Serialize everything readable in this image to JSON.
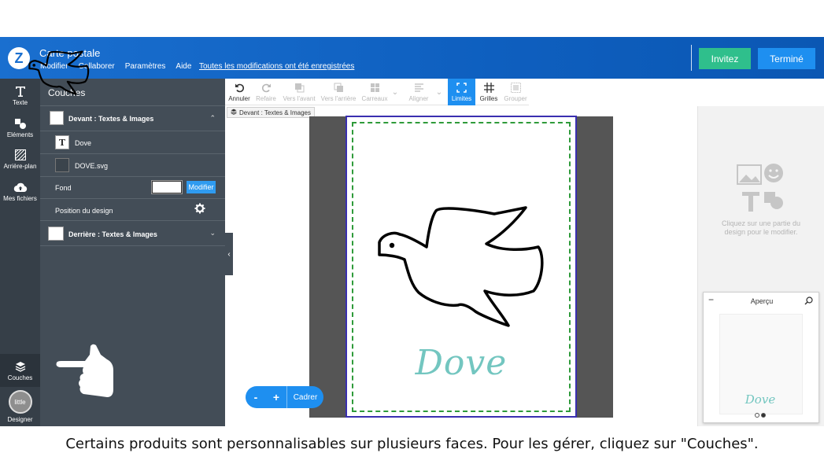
{
  "header": {
    "title": "Carte postale",
    "menu": [
      "Modifier",
      "Collaborer",
      "Paramètres",
      "Aide"
    ],
    "saved_status": "Toutes les modifications ont été enregistrées",
    "invite_label": "Invitez",
    "done_label": "Terminé",
    "logo_icon": "zazzle-logo-icon"
  },
  "rail": {
    "items": [
      {
        "label": "Texte",
        "icon": "text-icon"
      },
      {
        "label": "Eléments",
        "icon": "elements-icon"
      },
      {
        "label": "Arrière-plan",
        "icon": "background-icon"
      },
      {
        "label": "Mes fichiers",
        "icon": "upload-cloud-icon"
      }
    ],
    "layers_label": "Couches",
    "designer_label": "Designer",
    "designer_badge": "little"
  },
  "layers": {
    "title": "Couches",
    "front_group": "Devant : Textes & Images",
    "items": [
      "Dove",
      "DOVE.svg"
    ],
    "fond_label": "Fond",
    "fond_button": "Modifier",
    "position_label": "Position du design",
    "back_group": "Derrière : Textes & Images"
  },
  "toolbar": {
    "tools": [
      {
        "label": "Annuler",
        "icon": "undo-icon",
        "enabled": true
      },
      {
        "label": "Refaire",
        "icon": "redo-icon",
        "enabled": false
      },
      {
        "label": "Vers l'avant",
        "icon": "bring-forward-icon",
        "enabled": false
      },
      {
        "label": "Vers l'arrière",
        "icon": "send-backward-icon",
        "enabled": false
      },
      {
        "label": "Carreaux",
        "icon": "tiles-icon",
        "enabled": false
      },
      {
        "label": "Aligner",
        "icon": "align-icon",
        "enabled": false
      },
      {
        "label": "Limites",
        "icon": "bounds-icon",
        "enabled": true,
        "active": true
      },
      {
        "label": "Grilles",
        "icon": "grid-icon",
        "enabled": true
      },
      {
        "label": "Grouper",
        "icon": "group-icon",
        "enabled": false
      }
    ],
    "face_tag": "Devant : Textes & Images"
  },
  "canvas": {
    "card_text": "Dove",
    "text_color": "#73c6c0",
    "border_color": "#3a2fb0",
    "safe_line_color": "#2f9b3a"
  },
  "zoom": {
    "minus": "-",
    "plus": "+",
    "frame_label": "Cadrer"
  },
  "right_panel": {
    "hint": "Cliquez sur une partie du design pour le modifier."
  },
  "preview": {
    "title": "Aperçu",
    "minus": "−",
    "card_text": "Dove",
    "pages": 2,
    "active_page": 2
  },
  "caption": "Certains produits sont personnalisables sur plusieurs faces. Pour les gérer, cliquez sur \"Couches\"."
}
